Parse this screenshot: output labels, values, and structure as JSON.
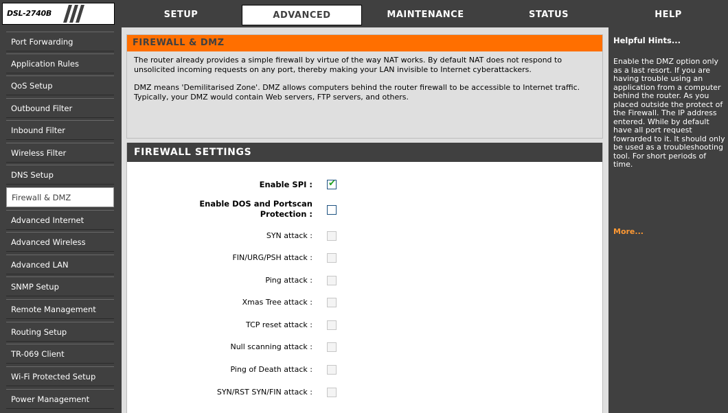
{
  "logo": {
    "model": "DSL-2740B"
  },
  "nav": {
    "tabs": [
      {
        "label": "SETUP"
      },
      {
        "label": "ADVANCED"
      },
      {
        "label": "MAINTENANCE"
      },
      {
        "label": "STATUS"
      },
      {
        "label": "HELP"
      }
    ],
    "active": "ADVANCED"
  },
  "sidebar": {
    "items": [
      {
        "label": "Port Forwarding"
      },
      {
        "label": "Application Rules"
      },
      {
        "label": "QoS Setup"
      },
      {
        "label": "Outbound Filter"
      },
      {
        "label": "Inbound Filter"
      },
      {
        "label": "Wireless Filter"
      },
      {
        "label": "DNS Setup"
      },
      {
        "label": "Firewall & DMZ"
      },
      {
        "label": "Advanced Internet"
      },
      {
        "label": "Advanced Wireless"
      },
      {
        "label": "Advanced LAN"
      },
      {
        "label": "SNMP Setup"
      },
      {
        "label": "Remote Management"
      },
      {
        "label": "Routing Setup"
      },
      {
        "label": "TR-069 Client"
      },
      {
        "label": "Wi-Fi Protected Setup"
      },
      {
        "label": "Power Management"
      }
    ],
    "active": "Firewall & DMZ"
  },
  "main": {
    "firewall_dmz": {
      "title": "FIREWALL & DMZ",
      "para1": "The router already provides a simple firewall by virtue of the way NAT works. By default NAT does not respond to unsolicited incoming requests on any port, thereby making your LAN invisible to Internet cyberattackers.",
      "para2": "DMZ means 'Demilitarised Zone'. DMZ allows computers behind the router firewall to be accessible to Internet traffic. Typically, your DMZ would contain Web servers, FTP servers, and others."
    },
    "firewall_settings": {
      "title": "FIREWALL SETTINGS",
      "rows": [
        {
          "label": "Enable SPI :",
          "checked": true,
          "enabled": true,
          "bold": true
        },
        {
          "label": "Enable DOS and Portscan",
          "label2": "Protection :",
          "checked": false,
          "enabled": true,
          "bold": true
        },
        {
          "label": "SYN attack :",
          "checked": false,
          "enabled": false,
          "bold": false
        },
        {
          "label": "FIN/URG/PSH attack :",
          "checked": false,
          "enabled": false,
          "bold": false
        },
        {
          "label": "Ping attack :",
          "checked": false,
          "enabled": false,
          "bold": false
        },
        {
          "label": "Xmas Tree attack :",
          "checked": false,
          "enabled": false,
          "bold": false
        },
        {
          "label": "TCP reset attack :",
          "checked": false,
          "enabled": false,
          "bold": false
        },
        {
          "label": "Null scanning attack :",
          "checked": false,
          "enabled": false,
          "bold": false
        },
        {
          "label": "Ping of Death attack :",
          "checked": false,
          "enabled": false,
          "bold": false
        },
        {
          "label": "SYN/RST SYN/FIN attack :",
          "checked": false,
          "enabled": false,
          "bold": false
        }
      ]
    }
  },
  "help": {
    "title": "Helpful Hints...",
    "body": "Enable the DMZ option only as a last resort. If you are having trouble using an application from a computer behind the router. As you placed outside the protect of the Firewall. The IP address entered. While by default have all port request fowrarded to it. It should only be used as a troubleshooting tool. For short periods of time.",
    "more": "More..."
  },
  "colors": {
    "nav_bg": "#404040",
    "accent_orange": "#ff6f00",
    "more_link": "#ff9933",
    "check_green": "#21a121"
  }
}
